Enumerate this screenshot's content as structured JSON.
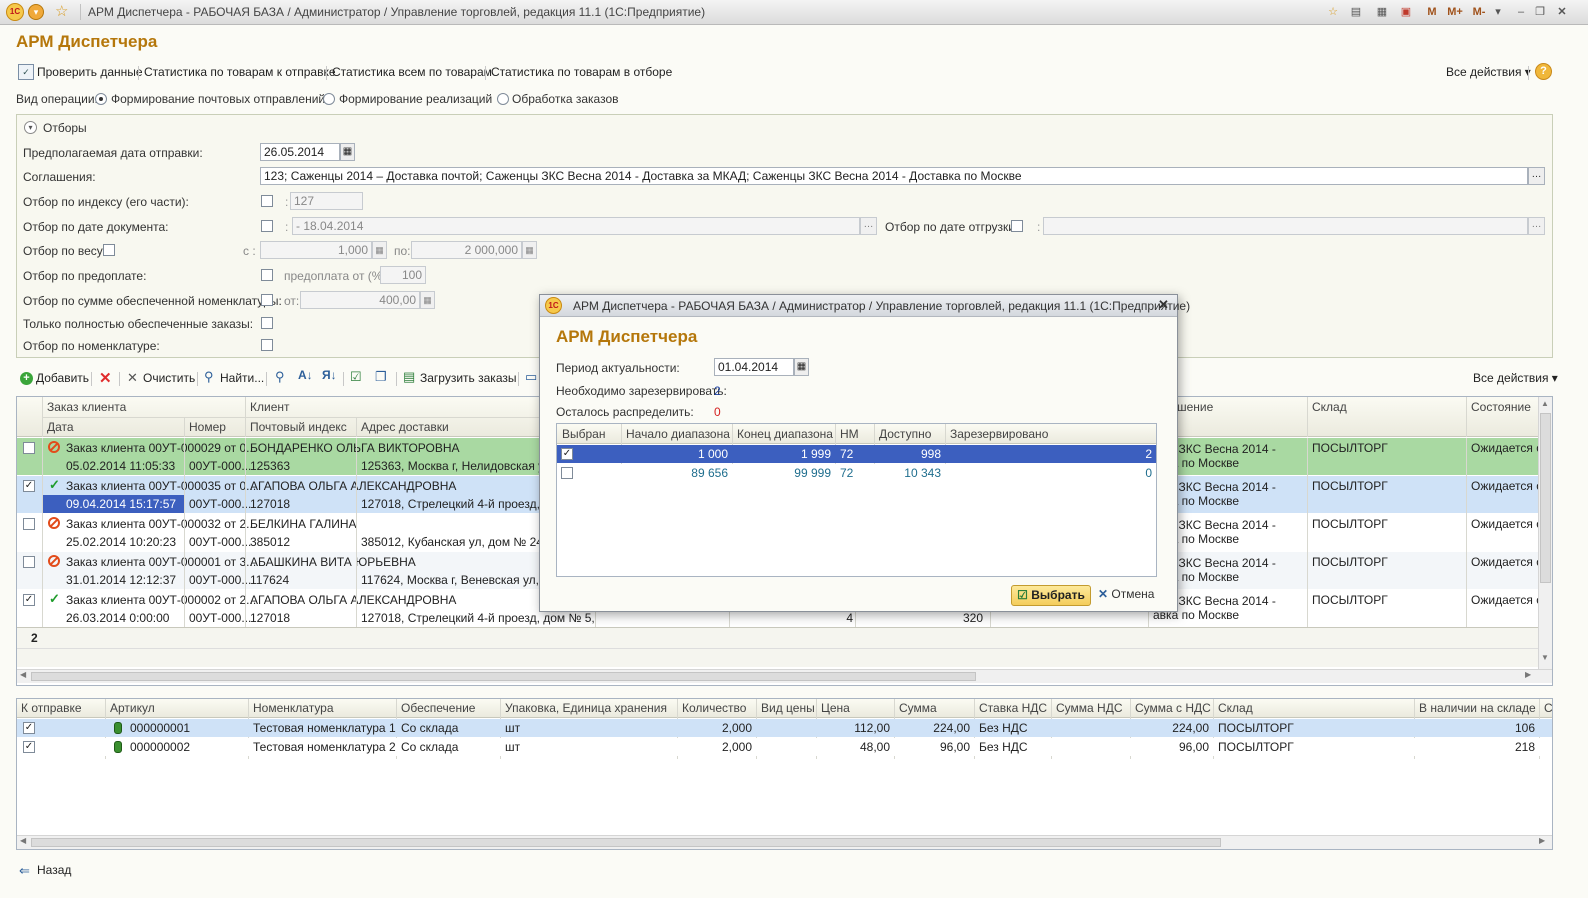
{
  "window": {
    "title": "АРМ Диспетчера - РАБОЧАЯ БАЗА / Администратор / Управление торговлей, редакция 11.1  (1С:Предприятие)",
    "logo": "1С",
    "right_icons": [
      "М",
      "М+",
      "М-"
    ]
  },
  "form": {
    "title": "АРМ Диспетчера",
    "toolbar": [
      "Проверить данные",
      "Статистика по товарам к отправке",
      "Статистика всем по товарам",
      "Статистика по товарам в отборе"
    ],
    "all_actions": "Все действия",
    "help": "?"
  },
  "operation": {
    "label": "Вид операции:",
    "options": [
      "Формирование почтовых отправлений",
      "Формирование реализаций",
      "Обработка заказов"
    ],
    "selected": 0
  },
  "filters": {
    "title": "Отборы",
    "ship_date_label": "Предполагаемая дата отправки:",
    "ship_date": "26.05.2014",
    "agreements_label": "Соглашения:",
    "agreements": "123; Саженцы 2014 – Доставка почтой; Саженцы ЗКС Весна 2014 - Доставка за МКАД; Саженцы ЗКС Весна 2014 - Доставка по Москве",
    "index_label": "Отбор по индексу (его части):",
    "index_value": "127",
    "doc_date_label": "Отбор по дате документа:",
    "doc_date_value": "- 18.04.2014",
    "ship_filter_label": "Отбор по дате отгрузки:",
    "weight_label": "Отбор по весу:",
    "weight_from_label": "с :",
    "weight_from": "1,000",
    "weight_to_label": "по:",
    "weight_to": "2 000,000",
    "prepay_label": "Отбор по предоплате:",
    "prepay_from_label": "предоплата от (%):",
    "prepay_from": "100",
    "sum_label": "Отбор по сумме обеспеченной номенклатуры:",
    "sum_from_label": "от:",
    "sum_from": "400,00",
    "full_label": "Только полностью обеспеченные заказы:",
    "nomen_label": "Отбор по номенклатуре:"
  },
  "orders_toolbar": {
    "add": "Добавить",
    "clear": "Очистить",
    "find": "Найти...",
    "load": "Загрузить заказы",
    "all_actions": "Все действия"
  },
  "orders_grid": {
    "headers_top": [
      "Заказ клиента",
      "Клиент",
      "шение",
      "Склад",
      "Состояние"
    ],
    "headers_bottom": [
      "Дата",
      "Номер",
      "Почтовый индекс",
      "Адрес доставки"
    ],
    "rows": [
      {
        "checked": false,
        "status": "cancel",
        "order": "Заказ клиента 00УТ-000029 от 0...",
        "client": "БОНДАРЕНКО ОЛЬГА ВИКТОРОВНА",
        "date": "05.02.2014 11:05:33",
        "number": "00УТ-000...",
        "index": "125363",
        "address": "125363, Москва г, Нелидовская ул,",
        "agreement": "нцы ЗКС Весна 2014 - авка по Москве",
        "warehouse": "ПОСЫЛТОРГ",
        "state": "Ожидается о"
      },
      {
        "checked": true,
        "status": "ok",
        "order": "Заказ клиента 00УТ-000035 от 0...",
        "client": "АГАПОВА ОЛЬГА АЛЕКСАНДРОВНА",
        "date": "09.04.2014 15:17:57",
        "number": "00УТ-000...",
        "index": "127018",
        "address": "127018, Стрелецкий 4-й проезд, до",
        "agreement": "нцы ЗКС Весна 2014 - авка по Москве",
        "warehouse": "ПОСЫЛТОРГ",
        "state": "Ожидается о"
      },
      {
        "checked": false,
        "status": "cancel",
        "order": "Заказ клиента 00УТ-000032 от 2...",
        "client": "БЕЛКИНА ГАЛИНА",
        "date": "25.02.2014 10:20:23",
        "number": "00УТ-000...",
        "index": "385012",
        "address": "385012, Кубанская ул, дом № 24, кв",
        "agreement": "нцы ЗКС Весна 2014 - авка по Москве",
        "warehouse": "ПОСЫЛТОРГ",
        "state": "Ожидается о"
      },
      {
        "checked": false,
        "status": "cancel",
        "order": "Заказ клиента 00УТ-000001 от 3...",
        "client": "АБАШКИНА ВИТА ЮРЬЕВНА",
        "date": "31.01.2014 12:12:37",
        "number": "00УТ-000...",
        "index": "117624",
        "address": "117624, Москва г, Веневская ул, д",
        "agreement": "нцы ЗКС Весна 2014 - авка по Москве",
        "warehouse": "ПОСЫЛТОРГ",
        "state": "Ожидается о"
      },
      {
        "checked": true,
        "status": "ok",
        "order": "Заказ клиента 00УТ-000002 от 2...",
        "client": "АГАПОВА ОЛЬГА АЛЕКСАНДРОВНА",
        "date": "26.03.2014 0:00:00",
        "number": "00УТ-000...",
        "index": "127018",
        "address": "127018, Стрелецкий 4-й проезд, дом № 5, к...",
        "qty": "4",
        "amount": "320",
        "agreement": "нцы ЗКС Весна 2014 - авка по Москве",
        "warehouse": "ПОСЫЛТОРГ",
        "state": "Ожидается о"
      }
    ],
    "footer_count": "2"
  },
  "items_grid": {
    "headers": [
      "К отправке",
      "Артикул",
      "Номенклатура",
      "Обеспечение",
      "Упаковка, Единица хранения",
      "Количество",
      "Вид цены",
      "Цена",
      "Сумма",
      "Ставка НДС",
      "Сумма НДС",
      "Сумма с НДС",
      "Склад",
      "В наличии на складе",
      "С"
    ],
    "rows": [
      {
        "checked": true,
        "article": "000000001",
        "name": "Тестовая номенклатура 1",
        "supply": "Со склада",
        "unit": "шт",
        "qty": "2,000",
        "price_type": "",
        "price": "112,00",
        "sum": "224,00",
        "vat": "Без НДС",
        "vat_sum": "",
        "total": "224,00",
        "warehouse": "ПОСЫЛТОРГ",
        "stock": "106"
      },
      {
        "checked": true,
        "article": "000000002",
        "name": "Тестовая номенклатура 2",
        "supply": "Со склада",
        "unit": "шт",
        "qty": "2,000",
        "price_type": "",
        "price": "48,00",
        "sum": "96,00",
        "vat": "Без НДС",
        "vat_sum": "",
        "total": "96,00",
        "warehouse": "ПОСЫЛТОРГ",
        "stock": "218"
      }
    ]
  },
  "back": "Назад",
  "dialog": {
    "title": "АРМ Диспетчера - РАБОЧАЯ БАЗА / Администратор / Управление торговлей, редакция 11.1  (1С:Предприятие)",
    "heading": "АРМ Диспетчера",
    "period_label": "Период актуальности:",
    "period_value": "01.04.2014",
    "need_label": "Необходимо зарезервировать:",
    "need_value": "2",
    "left_label": "Осталось распределить:",
    "left_value": "0",
    "headers": [
      "Выбран",
      "Начало диапазона",
      "Конец диапазона",
      "НМ",
      "Доступно",
      "Зарезервировано"
    ],
    "rows": [
      {
        "checked": true,
        "start": "1 000",
        "end": "1 999",
        "nm": "72",
        "avail": "998",
        "reserved": "2"
      },
      {
        "checked": false,
        "start": "89 656",
        "end": "99 999",
        "nm": "72",
        "avail": "10 343",
        "reserved": "0"
      }
    ],
    "ok": "Выбрать",
    "cancel": "Отмена"
  },
  "colors": {
    "accent": "#b5770b",
    "row_green": "#a9d9a2",
    "row_blue": "#cfe2f7",
    "selection": "#3c5fbf",
    "warning_red": "#e24c1b"
  }
}
